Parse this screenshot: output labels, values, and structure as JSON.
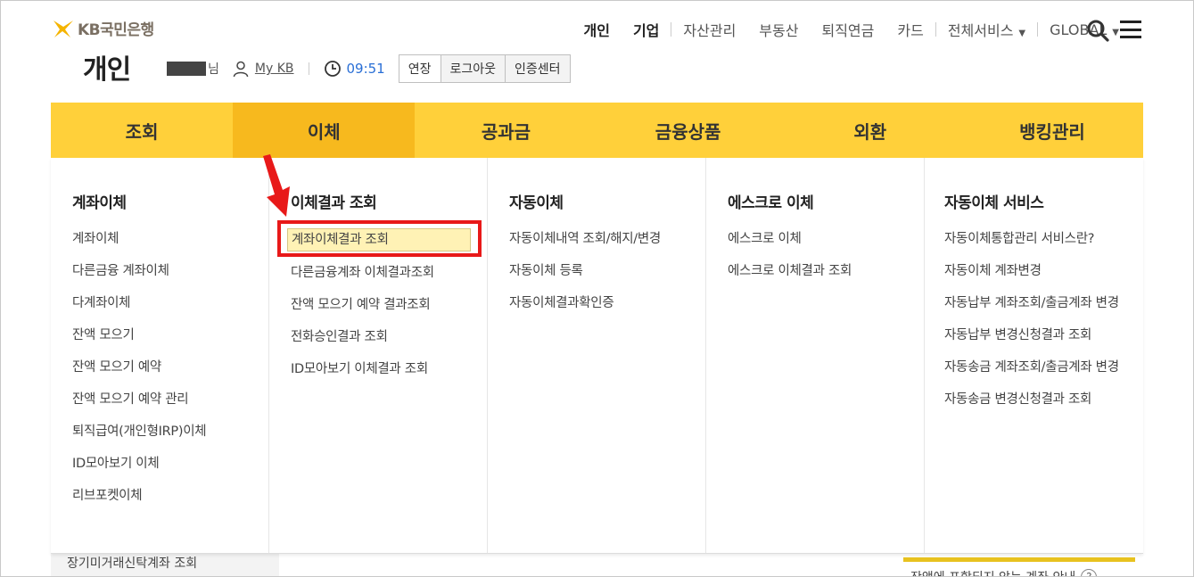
{
  "brand": {
    "name": "KB국민은행"
  },
  "top_nav": {
    "items": [
      "개인",
      "기업",
      "자산관리",
      "부동산",
      "퇴직연금",
      "카드",
      "전체서비스",
      "GLOBAL"
    ]
  },
  "page_title": "개인",
  "user": {
    "name_suffix": "님",
    "mykb_label": "My KB",
    "time": "09:51",
    "extend_label": "연장",
    "logout_label": "로그아웃",
    "cert_label": "인증센터"
  },
  "gnb": {
    "tabs": [
      "조회",
      "이체",
      "공과금",
      "금융상품",
      "외환",
      "뱅킹관리"
    ],
    "active_index": 1
  },
  "mega_menu": {
    "columns": [
      {
        "title": "계좌이체",
        "items": [
          "계좌이체",
          "다른금융 계좌이체",
          "다계좌이체",
          "잔액 모으기",
          "잔액 모으기 예약",
          "잔액 모으기 예약 관리",
          "퇴직급여(개인형IRP)이체",
          "ID모아보기 이체",
          "리브포켓이체"
        ]
      },
      {
        "title": "이체결과 조회",
        "items": [
          "계좌이체결과 조회",
          "다른금융계좌 이체결과조회",
          "잔액 모으기 예약 결과조회",
          "전화승인결과 조회",
          "ID모아보기 이체결과 조회"
        ]
      },
      {
        "title": "자동이체",
        "items": [
          "자동이체내역 조회/해지/변경",
          "자동이체 등록",
          "자동이체결과확인증"
        ]
      },
      {
        "title": "에스크로 이체",
        "items": [
          "에스크로 이체",
          "에스크로 이체결과 조회"
        ]
      },
      {
        "title": "자동이체 서비스",
        "items": [
          "자동이체통합관리 서비스란?",
          "자동이체 계좌변경",
          "자동납부 계좌조회/출금계좌 변경",
          "자동납부 변경신청결과 조회",
          "자동송금 계좌조회/출금계좌 변경",
          "자동송금 변경신청결과 조회"
        ]
      }
    ]
  },
  "background": {
    "left_peek": "장기미거래신탁계좌 조회",
    "right_peek": "잔액에 포함되지 않는 계좌 안내"
  },
  "colors": {
    "gnb": "#ffd03a",
    "gnb_active": "#f7b91e",
    "highlight": "#e81919",
    "time": "#2a6fd6"
  }
}
